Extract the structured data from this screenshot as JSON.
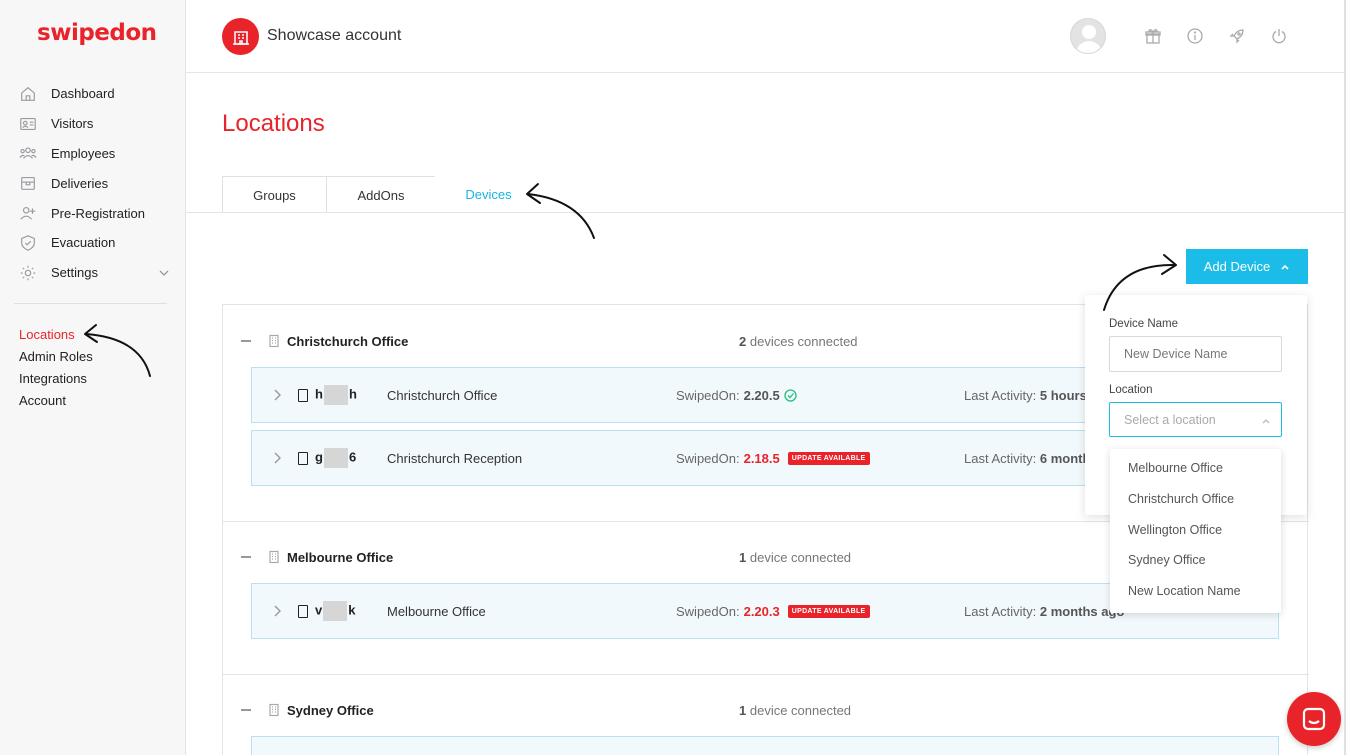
{
  "brand": {
    "logo": "swipedon",
    "accent": "#e8242a",
    "primary_blue": "#1bbde8"
  },
  "sidebar": {
    "items": [
      {
        "label": "Dashboard",
        "icon": "home-icon"
      },
      {
        "label": "Visitors",
        "icon": "id-card-icon"
      },
      {
        "label": "Employees",
        "icon": "people-icon"
      },
      {
        "label": "Deliveries",
        "icon": "package-icon"
      },
      {
        "label": "Pre-Registration",
        "icon": "add-user-icon"
      },
      {
        "label": "Evacuation",
        "icon": "shield-icon"
      },
      {
        "label": "Settings",
        "icon": "gear-icon"
      }
    ],
    "sub_items": [
      {
        "label": "Locations",
        "active": true
      },
      {
        "label": "Admin Roles"
      },
      {
        "label": "Integrations"
      },
      {
        "label": "Account"
      }
    ]
  },
  "header": {
    "account_name": "Showcase account"
  },
  "main": {
    "title": "Locations",
    "tabs": [
      {
        "label": "Groups"
      },
      {
        "label": "AddOns"
      },
      {
        "label": "Devices",
        "active": true
      }
    ],
    "add_device_label": "Add Device",
    "locations": [
      {
        "name": "Christchurch Office",
        "count_num": "2",
        "count_text": "devices connected",
        "devices": [
          {
            "id_start": "h",
            "id_end": "h",
            "location": "Christchurch Office",
            "ver_label": "SwipedOn:",
            "version": "2.20.5",
            "status": "ok",
            "act_label": "Last Activity:",
            "activity": "5 hours"
          },
          {
            "id_start": "g",
            "id_end": "6",
            "location": "Christchurch Reception",
            "ver_label": "SwipedOn:",
            "version": "2.18.5",
            "status": "update",
            "badge": "UPDATE AVAILABLE",
            "act_label": "Last Activity:",
            "activity": "6 month"
          }
        ]
      },
      {
        "name": "Melbourne Office",
        "count_num": "1",
        "count_text": "device connected",
        "devices": [
          {
            "id_start": "v",
            "id_end": "k",
            "location": "Melbourne Office",
            "ver_label": "SwipedOn:",
            "version": "2.20.3",
            "status": "update",
            "badge": "UPDATE AVAILABLE",
            "act_label": "Last Activity:",
            "activity": "2 months ago"
          }
        ]
      },
      {
        "name": "Sydney Office",
        "count_num": "1",
        "count_text": "device connected"
      }
    ]
  },
  "add_device_form": {
    "device_name_label": "Device Name",
    "device_name_placeholder": "New Device Name",
    "location_label": "Location",
    "location_placeholder": "Select a location",
    "options": [
      "Melbourne Office",
      "Christchurch Office",
      "Wellington Office",
      "Sydney Office",
      "New Location Name"
    ]
  }
}
